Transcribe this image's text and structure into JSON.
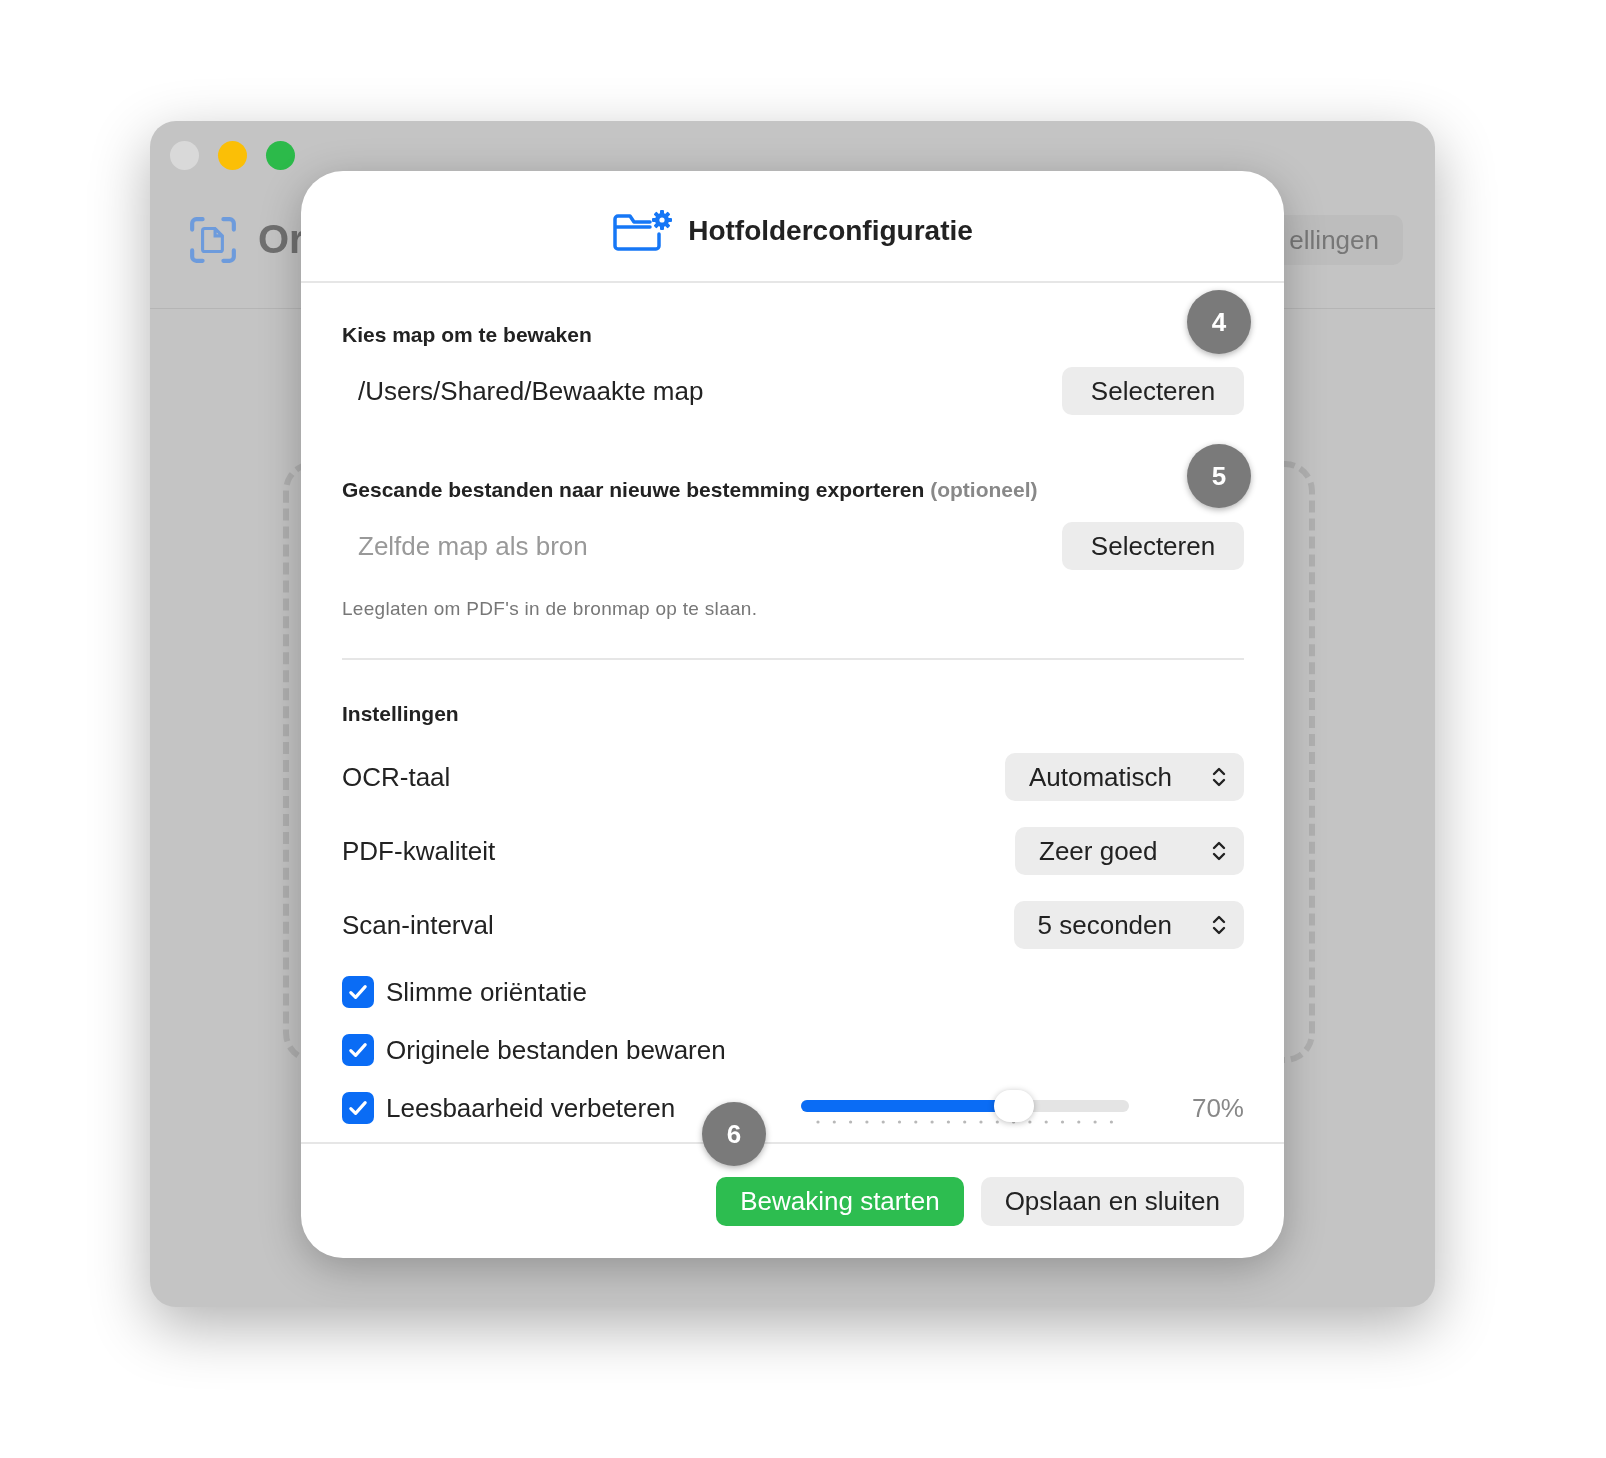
{
  "background_window": {
    "app_title": "Or",
    "toolbar_button": "ellingen"
  },
  "dialog": {
    "title": "Hotfolderconfiguratie",
    "watch_folder": {
      "label": "Kies map om te bewaken",
      "value": "/Users/Shared/Bewaakte map",
      "button": "Selecteren"
    },
    "export_folder": {
      "label": "Gescande bestanden naar nieuwe bestemming exporteren",
      "label_suffix": "(optioneel)",
      "placeholder": "Zelfde map als bron",
      "button": "Selecteren",
      "hint": "Leeglaten om PDF's in de bronmap op te slaan."
    },
    "settings_heading": "Instellingen",
    "selects": [
      {
        "label": "OCR-taal",
        "value": "Automatisch"
      },
      {
        "label": "PDF-kwaliteit",
        "value": "Zeer goed"
      },
      {
        "label": "Scan-interval",
        "value": "5 seconden"
      }
    ],
    "checkboxes": [
      {
        "label": "Slimme oriëntatie",
        "checked": true
      },
      {
        "label": "Originele bestanden bewaren",
        "checked": true
      },
      {
        "label": "Leesbaarheid verbeteren",
        "checked": true,
        "slider": {
          "level": 0.65,
          "reading": "70%"
        }
      }
    ],
    "buttons": [
      {
        "label": "Bewaking starten",
        "kind": "primary"
      },
      {
        "label": "Opslaan en sluiten",
        "kind": "secondary"
      }
    ]
  },
  "step_badges": [
    "4",
    "5",
    "6"
  ]
}
